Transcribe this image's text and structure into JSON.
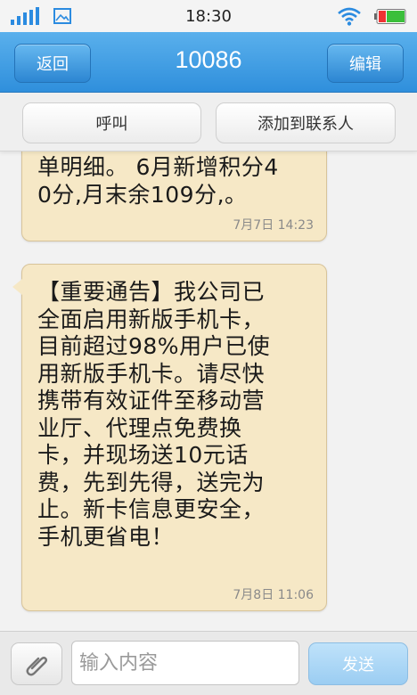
{
  "status_bar": {
    "time": "18:30",
    "icons": [
      "signal-icon",
      "gallery-icon",
      "wifi-icon",
      "battery-icon"
    ]
  },
  "header": {
    "back_label": "返回",
    "title": "10086",
    "edit_label": "编辑"
  },
  "actions": {
    "call_label": "呼叫",
    "add_contact_label": "添加到联系人"
  },
  "messages": [
    {
      "text": "单明细。 6月新增积分4\n0分,月末余109分,。",
      "time": "7月7日 14:23"
    },
    {
      "text": "【重要通告】我公司已\n全面启用新版手机卡，\n目前超过98%用户已使\n用新版手机卡。请尽快\n携带有效证件至移动营\n业厅、代理点免费换\n卡，并现场送10元话\n费，先到先得，送完为\n止。新卡信息更安全，\n手机更省电！",
      "time": "7月8日 11:06"
    }
  ],
  "composer": {
    "placeholder": "输入内容",
    "value": "",
    "send_label": "发送",
    "attach_icon": "paperclip-icon"
  },
  "colors": {
    "header_blue": "#2f8fdc",
    "bubble": "#f6e8c6",
    "send_disabled": "#9bcdf2"
  }
}
